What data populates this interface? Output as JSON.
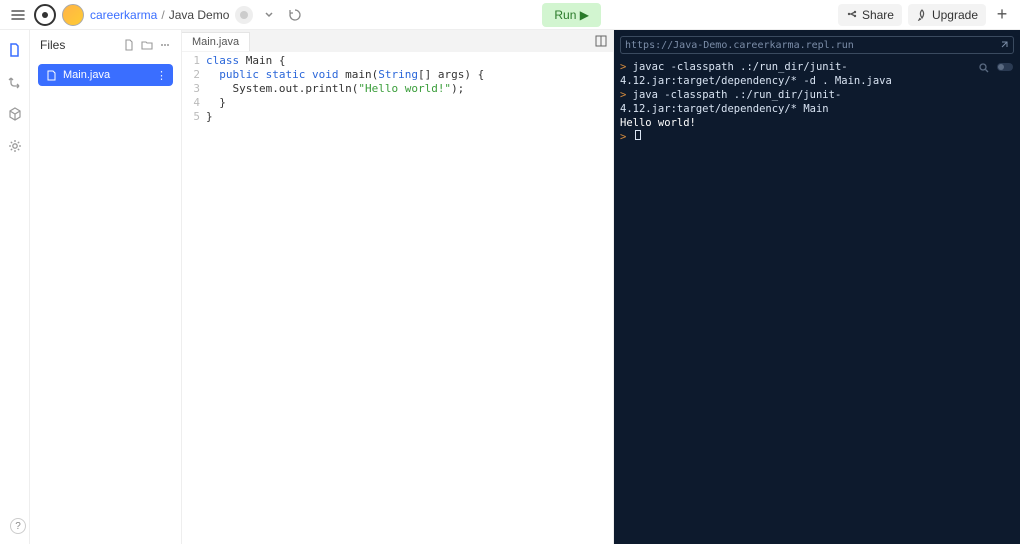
{
  "header": {
    "username": "careerkarma",
    "project": "Java Demo",
    "separator": "/",
    "run_label": "Run ▶",
    "share_label": "Share",
    "upgrade_label": "Upgrade"
  },
  "sidebar": {
    "title": "Files",
    "files": [
      {
        "name": "Main.java"
      }
    ]
  },
  "editor": {
    "tab_label": "Main.java",
    "lines": [
      {
        "n": "1",
        "indent": "",
        "tokens": [
          [
            "kw",
            "class"
          ],
          [
            "",
            " "
          ],
          [
            "cls",
            "Main"
          ],
          [
            "",
            " {"
          ]
        ]
      },
      {
        "n": "2",
        "indent": "  ",
        "tokens": [
          [
            "kw",
            "public"
          ],
          [
            "",
            " "
          ],
          [
            "kw",
            "static"
          ],
          [
            "",
            " "
          ],
          [
            "type",
            "void"
          ],
          [
            "",
            " main("
          ],
          [
            "type",
            "String"
          ],
          [
            "",
            "[] args) {"
          ]
        ]
      },
      {
        "n": "3",
        "indent": "    ",
        "tokens": [
          [
            "",
            "System.out.println("
          ],
          [
            "str",
            "\"Hello world!\""
          ],
          [
            "",
            ");"
          ]
        ]
      },
      {
        "n": "4",
        "indent": "  ",
        "tokens": [
          [
            "",
            "}"
          ]
        ]
      },
      {
        "n": "5",
        "indent": "",
        "tokens": [
          [
            "",
            "}"
          ]
        ]
      }
    ]
  },
  "console": {
    "url": "https://Java-Demo.careerkarma.repl.run",
    "lines": [
      {
        "type": "cmd",
        "text": "javac -classpath .:/run_dir/junit-4.12.jar:target/dependency/* -d . Main.java"
      },
      {
        "type": "cmd",
        "text": "java -classpath .:/run_dir/junit-4.12.jar:target/dependency/* Main"
      },
      {
        "type": "out",
        "text": "Hello world!"
      },
      {
        "type": "prompt",
        "text": ""
      }
    ]
  },
  "icons": {
    "help": "?"
  }
}
